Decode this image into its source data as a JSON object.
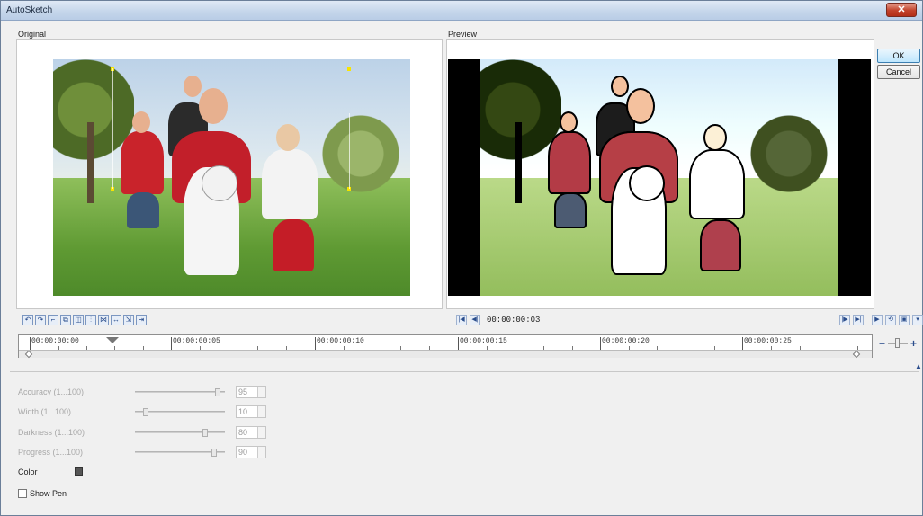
{
  "window": {
    "title": "AutoSketch"
  },
  "panels": {
    "original_label": "Original",
    "preview_label": "Preview"
  },
  "buttons": {
    "ok": "OK",
    "cancel": "Cancel"
  },
  "transport": {
    "timecode": "00:00:00:03"
  },
  "timeline": {
    "labels": [
      "00:00:00:00",
      "00:00:00:05",
      "00:00:00:10",
      "00:00:00:15",
      "00:00:00:20",
      "00:00:00:25"
    ]
  },
  "params": [
    {
      "label": "Accuracy (1...100)",
      "value": "95",
      "fraction": 0.95
    },
    {
      "label": "Width (1...100)",
      "value": "10",
      "fraction": 0.1
    },
    {
      "label": "Darkness (1...100)",
      "value": "80",
      "fraction": 0.8
    },
    {
      "label": "Progress (1...100)",
      "value": "90",
      "fraction": 0.9
    }
  ],
  "color": {
    "label": "Color",
    "swatch": "#555555"
  },
  "show_pen": {
    "label": "Show Pen",
    "checked": false
  },
  "icons": [
    "undo-icon",
    "redo-icon",
    "cut-icon",
    "copy-icon",
    "paste-icon",
    "split-icon",
    "join-icon",
    "move-icon",
    "fit-icon",
    "snap-icon"
  ],
  "colors": {
    "marker": "#f7e400",
    "close": "#c2412a",
    "accent": "#2a4d8c"
  }
}
